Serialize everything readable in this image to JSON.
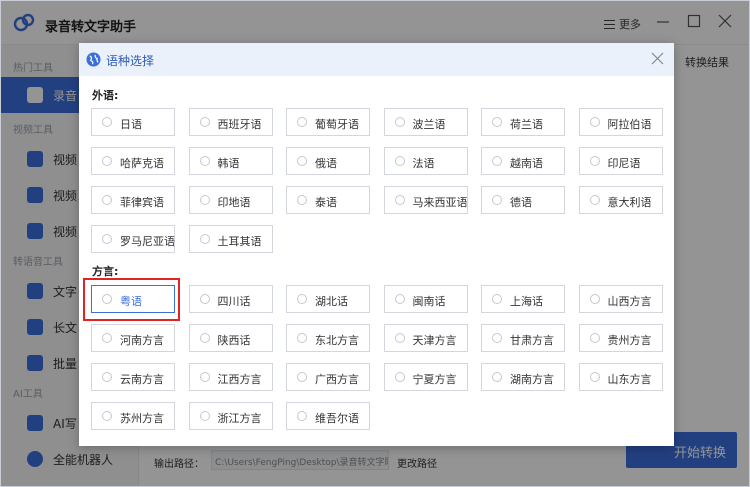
{
  "app": {
    "title": "录音转文字助手",
    "more_label": "更多",
    "export_label": "转换结果"
  },
  "sidebar": {
    "sections": [
      {
        "label": "热门工具"
      },
      {
        "label": "视频工具"
      },
      {
        "label": "转语音工具"
      },
      {
        "label": "AI工具"
      }
    ],
    "items": [
      {
        "label": "录音",
        "color": "#3c6fdc"
      },
      {
        "label": "视频",
        "color": "#3c6fdc"
      },
      {
        "label": "视频",
        "color": "#3c6fdc"
      },
      {
        "label": "视频",
        "color": "#3c6fdc"
      },
      {
        "label": "文字",
        "color": "#3c6fdc"
      },
      {
        "label": "长文",
        "color": "#3c6fdc"
      },
      {
        "label": "批量",
        "color": "#3c6fdc"
      },
      {
        "label": "AI写",
        "color": "#3c6fdc"
      },
      {
        "label": "全能机器人",
        "color": "#3c6fdc"
      }
    ]
  },
  "main": {
    "output_label": "输出路径：",
    "output_path": "C:\\Users\\FengPing\\Desktop\\录音转文字助手",
    "change_path": "更改路径",
    "start_button": "开始转换"
  },
  "modal": {
    "title": "语种选择",
    "foreign_label": "外语:",
    "foreign": [
      "日语",
      "西班牙语",
      "葡萄牙语",
      "波兰语",
      "荷兰语",
      "阿拉伯语",
      "哈萨克语",
      "韩语",
      "俄语",
      "法语",
      "越南语",
      "印尼语",
      "菲律宾语",
      "印地语",
      "泰语",
      "马来西亚语",
      "德语",
      "意大利语",
      "罗马尼亚语",
      "土耳其语"
    ],
    "dialect_label": "方言:",
    "dialects": [
      "粤语",
      "四川话",
      "湖北话",
      "闽南话",
      "上海话",
      "山西方言",
      "河南方言",
      "陕西话",
      "东北方言",
      "天津方言",
      "甘肃方言",
      "贵州方言",
      "云南方言",
      "江西方言",
      "广西方言",
      "宁夏方言",
      "湖南方言",
      "山东方言",
      "苏州方言",
      "浙江方言",
      "维吾尔语"
    ],
    "selected": "粤语"
  },
  "colors": {
    "accent": "#3c6fdc",
    "highlight_border": "#e02424",
    "modal_header": "#eaf1fb"
  },
  "icons": [
    "app-logo-icon",
    "menu-icon",
    "minimize-icon",
    "maximize-icon",
    "close-icon",
    "globe-icon",
    "modal-close-icon"
  ]
}
